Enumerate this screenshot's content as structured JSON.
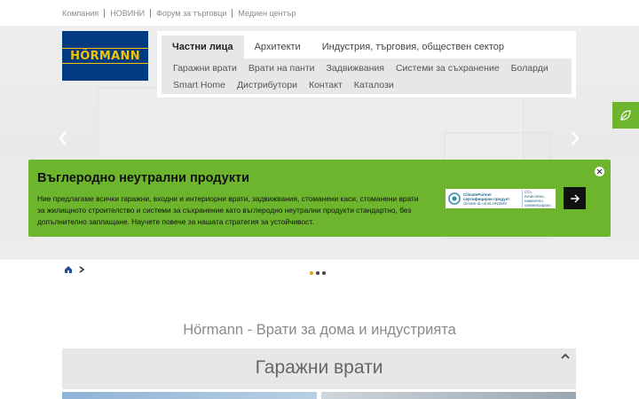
{
  "top_links": [
    "Компания",
    "НОВИНИ",
    "Форум за търговци",
    "Медиен център"
  ],
  "logo": {
    "text": "HÖRMANN",
    "bg_color": "#003a80",
    "text_color": "#f4c400"
  },
  "nav": {
    "tabs": [
      {
        "label": "Частни лица",
        "active": true
      },
      {
        "label": "Архитекти",
        "active": false
      },
      {
        "label": "Индустрия, търговия, обществен сектор",
        "active": false
      }
    ],
    "sub_items": [
      "Гаражни врати",
      "Врати на панти",
      "Задвижвания",
      "Системи за съхранение",
      "Боларди",
      "Smart Home",
      "Дистрибутори",
      "Контакт",
      "Каталози"
    ]
  },
  "side_tab": {
    "icon": "leaf-icon",
    "color": "#6cb52d"
  },
  "banner": {
    "title": "Въглеродно неутрални продукти",
    "text": "Ние предлагаме всички гаражни, входни и интериорни врати, задвижвания, стоманени каси, стоманени врати за жилищното строителство и системи за съхранение като въглеродно неутрални продукти стандартно, без допълнително заплащане. Научете повече за нашата стратегия за устойчивост.",
    "badge_text": "ClimatePartner сертифициран продукт",
    "badge_sub": "climate-id.com/LHNSMS",
    "badge_co2": "CO₂ изчислено, намалено, компенсирано",
    "color": "#6cb52d"
  },
  "carousel": {
    "slides": 3,
    "active_index": 0
  },
  "section": {
    "heading": "Hörmann - Врати за дома и индустрията",
    "category": "Гаражни врати"
  }
}
